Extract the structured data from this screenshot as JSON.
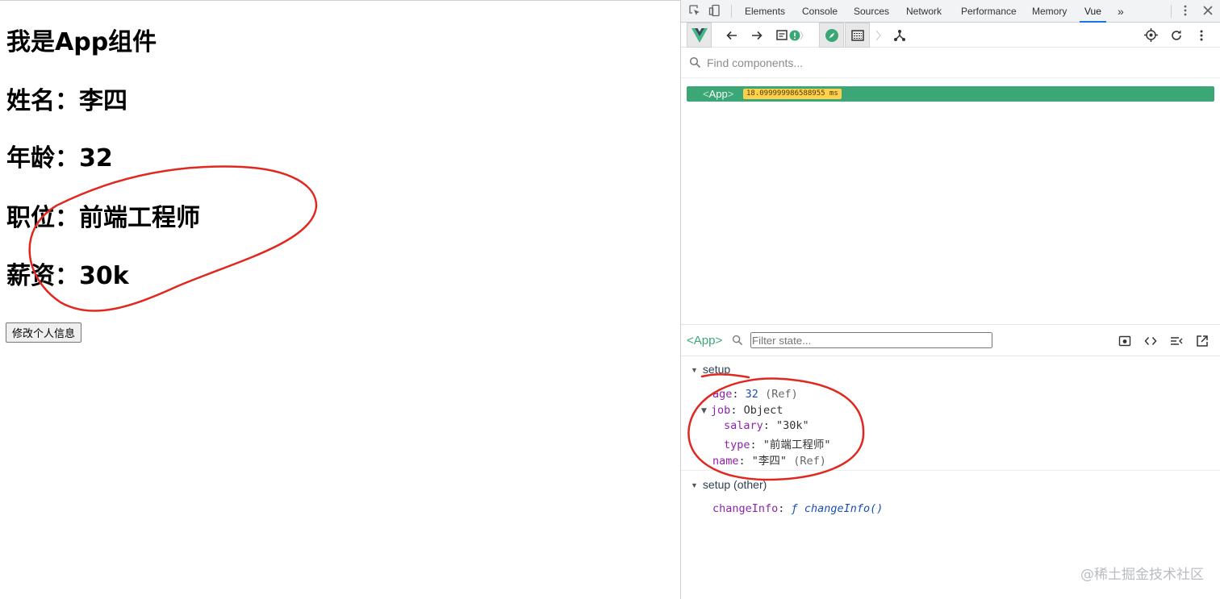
{
  "page": {
    "heading": "我是App组件",
    "name_line": "姓名：李四",
    "age_line": "年龄：32",
    "job_line": "职位：前端工程师",
    "salary_line": "薪资：30k",
    "button_label": "修改个人信息"
  },
  "devtools": {
    "tabs": [
      "Elements",
      "Console",
      "Sources",
      "Network",
      "Performance",
      "Memory",
      "Vue"
    ],
    "active_tab": "Vue",
    "more_tabs": "»",
    "find_placeholder": "Find components...",
    "tree": {
      "open_bracket": "<",
      "component": "App",
      "close_bracket": ">",
      "timing": "18.099999986588955 ms"
    },
    "inspector": {
      "component": "<App>",
      "filter_placeholder": "Filter state..."
    },
    "setup": {
      "title": "setup",
      "age_key": "age",
      "age_value": "32",
      "age_meta": "(Ref)",
      "job_key": "job",
      "job_value": "Object",
      "salary_key": "salary",
      "salary_value": "\"30k\"",
      "type_key": "type",
      "type_value": "\"前端工程师\"",
      "name_key": "name",
      "name_value": "\"李四\"",
      "name_meta": "(Ref)"
    },
    "setup_other": {
      "title": "setup (other)",
      "fn_key": "changeInfo",
      "fn_prefix": "ƒ",
      "fn_value": "changeInfo()"
    },
    "colors": {
      "vue_green": "#3ba776",
      "timing_badge": "#ffd04b",
      "key_purple": "#8e24aa",
      "annotation_red": "#e0281e"
    }
  },
  "watermark": "@稀土掘金技术社区"
}
